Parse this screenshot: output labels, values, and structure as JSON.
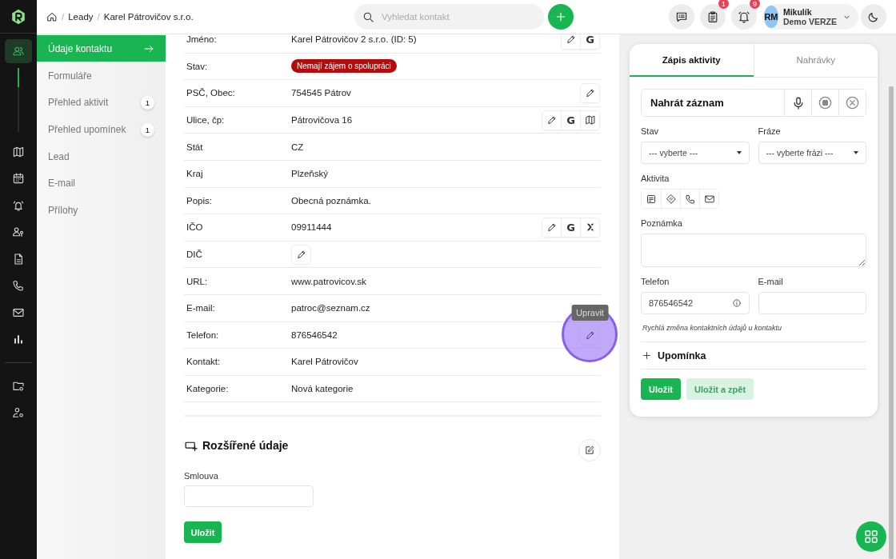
{
  "rail": [
    {
      "kind": "users",
      "selected": true
    },
    {
      "kind": "map",
      "selected": false
    },
    {
      "kind": "calendar",
      "selected": false
    },
    {
      "kind": "alarm",
      "selected": false
    },
    {
      "kind": "user-key",
      "selected": false
    },
    {
      "kind": "document",
      "selected": false
    },
    {
      "kind": "phone",
      "selected": false
    },
    {
      "kind": "mail",
      "selected": false
    },
    {
      "kind": "chart",
      "selected": false
    },
    {
      "kind": "folder-gear",
      "selected": false
    },
    {
      "kind": "user-gear",
      "selected": false
    }
  ],
  "breadcrumb": [
    {
      "separator": "/",
      "label": "Leady"
    },
    {
      "separator": "/",
      "label": "Karel Pátrovičov s.r.o."
    }
  ],
  "search": {
    "placeholder": "Vyhledat kontakt"
  },
  "header_buttons": [
    {
      "kind": "chat"
    },
    {
      "kind": "clipboard",
      "badge": "1"
    },
    {
      "kind": "bell",
      "badge": "9"
    }
  ],
  "user": {
    "initials": "RM",
    "name": "Mikulík",
    "subtitle": "Demo VERZE"
  },
  "subnav": [
    {
      "label": "Údaje kontaktu",
      "selected": true
    },
    {
      "label": "Formuláře",
      "selected": false
    },
    {
      "label": "Přehled aktivit",
      "count": "1",
      "selected": false
    },
    {
      "label": "Přehled upomínek",
      "count": "1",
      "selected": false
    },
    {
      "label": "Lead",
      "selected": false
    },
    {
      "label": "E-mail",
      "selected": false
    },
    {
      "label": "Přílohy",
      "selected": false
    }
  ],
  "fields": [
    {
      "label": "Jméno:",
      "value": "Karel Pátrovičov 2 s.r.o. (ID: 5)",
      "actions": [
        {
          "kind": "edit"
        },
        {
          "kind": "google",
          "label": "G"
        }
      ]
    },
    {
      "label": "Stav:",
      "badge": "Nemají zájem o spolupráci"
    },
    {
      "label": "PSČ, Obec:",
      "value": "754545 Pátrov",
      "actions": [
        {
          "kind": "edit"
        }
      ]
    },
    {
      "label": "Ulice, čp:",
      "value": "Pátrovičova 16",
      "actions": [
        {
          "kind": "edit"
        },
        {
          "kind": "google",
          "label": "G"
        },
        {
          "kind": "map"
        }
      ]
    },
    {
      "label": "Stát",
      "value": "CZ"
    },
    {
      "label": "Kraj",
      "value": "Plzeňský"
    },
    {
      "label": "Popis:",
      "value": "Obecná poznámka."
    },
    {
      "label": "IČO",
      "value": "09911444",
      "actions": [
        {
          "kind": "edit"
        },
        {
          "kind": "google",
          "label": "G"
        },
        {
          "kind": "registry"
        }
      ]
    },
    {
      "label": "DIČ",
      "inline_edit": true
    },
    {
      "label": "URL:",
      "value": "www.patrovicov.sk"
    },
    {
      "label": "E-mail:",
      "value": "patroc@seznam.cz"
    },
    {
      "label": "Telefon:",
      "value": "876546542",
      "actions": [
        {
          "kind": "edit",
          "clicked": true,
          "tooltip": "Upravit"
        }
      ]
    },
    {
      "label": "Kontakt:",
      "value": "Karel Pátrovičov"
    },
    {
      "label": "Kategorie:",
      "value": "Nová kategorie"
    }
  ],
  "extended": {
    "title": "Rozšířené údaje",
    "field_label": "Smlouva",
    "save": "Uložit"
  },
  "panel": {
    "tabs": [
      {
        "label": "Zápis aktivity",
        "selected": true
      },
      {
        "label": "Nahrávky",
        "selected": false
      }
    ],
    "recorder": {
      "label": "Nahrát záznam"
    },
    "selects": [
      {
        "label": "Stav",
        "value": "--- vyberte ---"
      },
      {
        "label": "Fráze",
        "value": "--- vyberte frázi ---"
      }
    ],
    "activity": {
      "label": "Aktivita",
      "types": [
        {
          "kind": "note"
        },
        {
          "kind": "tag"
        },
        {
          "kind": "phone"
        },
        {
          "kind": "mail"
        }
      ]
    },
    "note": {
      "label": "Poznámka"
    },
    "contacts": [
      {
        "label": "Telefon",
        "value": "876546542",
        "info": true
      },
      {
        "label": "E-mail"
      }
    ],
    "hint": "Rychlá změna kontaktních údajů u kontaktu",
    "reminder": {
      "label": "Upomínka",
      "expanded": false
    },
    "buttons": [
      {
        "label": "Uložit",
        "kind": "primary"
      },
      {
        "label": "Uložit a zpět",
        "kind": "secondary"
      }
    ]
  }
}
